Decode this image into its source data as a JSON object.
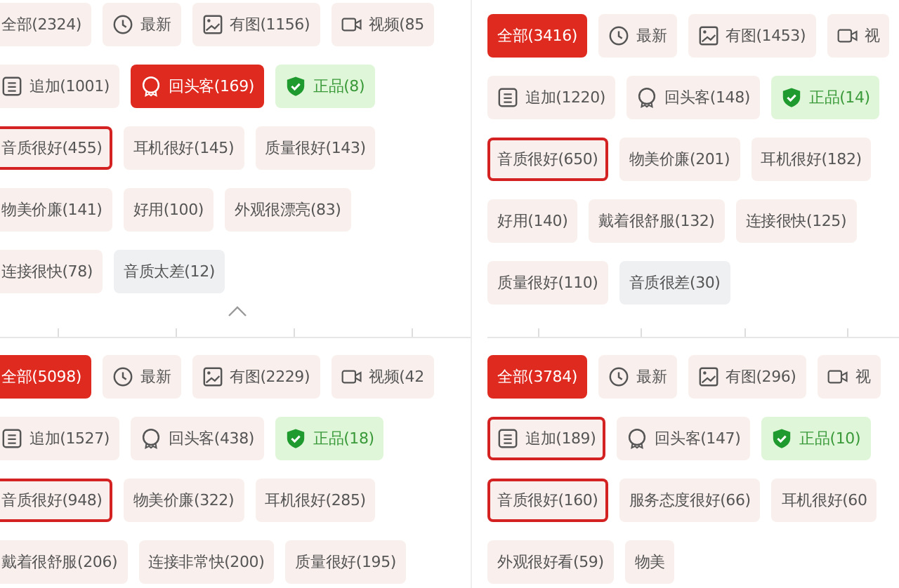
{
  "panels": [
    {
      "collapse_toggle": true,
      "ruler": false,
      "rows": [
        [
          {
            "kind": "tag",
            "label": "全部(2324)",
            "selected": false,
            "outlined": false
          },
          {
            "kind": "latest",
            "label": "最新",
            "selected": false,
            "outlined": false
          },
          {
            "kind": "photo",
            "label": "有图(1156)",
            "selected": false,
            "outlined": false
          },
          {
            "kind": "video",
            "label": "视频(85",
            "selected": false,
            "outlined": false
          }
        ],
        [
          {
            "kind": "followup",
            "label": "追加(1001)",
            "selected": false,
            "outlined": false
          },
          {
            "kind": "repeat",
            "label": "回头客(169)",
            "selected": true,
            "outlined": false
          },
          {
            "kind": "genuine",
            "label": "正品(8)",
            "selected": false,
            "outlined": false
          }
        ],
        [
          {
            "kind": "tag",
            "label": "音质很好(455)",
            "selected": false,
            "outlined": true
          },
          {
            "kind": "tag",
            "label": "耳机很好(145)",
            "selected": false,
            "outlined": false
          },
          {
            "kind": "tag",
            "label": "质量很好(143)",
            "selected": false,
            "outlined": false
          }
        ],
        [
          {
            "kind": "tag",
            "label": "物美价廉(141)",
            "selected": false,
            "outlined": false
          },
          {
            "kind": "tag",
            "label": "好用(100)",
            "selected": false,
            "outlined": false
          },
          {
            "kind": "tag",
            "label": "外观很漂亮(83)",
            "selected": false,
            "outlined": false
          }
        ],
        [
          {
            "kind": "tag",
            "label": "连接很快(78)",
            "selected": false,
            "outlined": false
          },
          {
            "kind": "negative",
            "label": "音质太差(12)",
            "selected": false,
            "outlined": false
          }
        ]
      ]
    },
    {
      "collapse_toggle": false,
      "ruler": false,
      "rows": [
        [
          {
            "kind": "tag",
            "label": "全部(3416)",
            "selected": true,
            "outlined": false
          },
          {
            "kind": "latest",
            "label": "最新",
            "selected": false,
            "outlined": false
          },
          {
            "kind": "photo",
            "label": "有图(1453)",
            "selected": false,
            "outlined": false
          },
          {
            "kind": "video",
            "label": "视",
            "selected": false,
            "outlined": false
          }
        ],
        [
          {
            "kind": "followup",
            "label": "追加(1220)",
            "selected": false,
            "outlined": false
          },
          {
            "kind": "repeat",
            "label": "回头客(148)",
            "selected": false,
            "outlined": false
          },
          {
            "kind": "genuine",
            "label": "正品(14)",
            "selected": false,
            "outlined": false
          }
        ],
        [
          {
            "kind": "tag",
            "label": "音质很好(650)",
            "selected": false,
            "outlined": true
          },
          {
            "kind": "tag",
            "label": "物美价廉(201)",
            "selected": false,
            "outlined": false
          },
          {
            "kind": "tag",
            "label": "耳机很好(182)",
            "selected": false,
            "outlined": false
          }
        ],
        [
          {
            "kind": "tag",
            "label": "好用(140)",
            "selected": false,
            "outlined": false
          },
          {
            "kind": "tag",
            "label": "戴着很舒服(132)",
            "selected": false,
            "outlined": false
          },
          {
            "kind": "tag",
            "label": "连接很快(125)",
            "selected": false,
            "outlined": false
          }
        ],
        [
          {
            "kind": "tag",
            "label": "质量很好(110)",
            "selected": false,
            "outlined": false
          },
          {
            "kind": "negative",
            "label": "音质很差(30)",
            "selected": false,
            "outlined": false
          }
        ]
      ]
    },
    {
      "collapse_toggle": false,
      "ruler": true,
      "rows": [
        [
          {
            "kind": "tag",
            "label": "全部(5098)",
            "selected": true,
            "outlined": false
          },
          {
            "kind": "latest",
            "label": "最新",
            "selected": false,
            "outlined": false
          },
          {
            "kind": "photo",
            "label": "有图(2229)",
            "selected": false,
            "outlined": false
          },
          {
            "kind": "video",
            "label": "视频(42",
            "selected": false,
            "outlined": false
          }
        ],
        [
          {
            "kind": "followup",
            "label": "追加(1527)",
            "selected": false,
            "outlined": false
          },
          {
            "kind": "repeat",
            "label": "回头客(438)",
            "selected": false,
            "outlined": false
          },
          {
            "kind": "genuine",
            "label": "正品(18)",
            "selected": false,
            "outlined": false
          }
        ],
        [
          {
            "kind": "tag",
            "label": "音质很好(948)",
            "selected": false,
            "outlined": true
          },
          {
            "kind": "tag",
            "label": "物美价廉(322)",
            "selected": false,
            "outlined": false
          },
          {
            "kind": "tag",
            "label": "耳机很好(285)",
            "selected": false,
            "outlined": false
          }
        ],
        [
          {
            "kind": "tag",
            "label": "戴着很舒服(206)",
            "selected": false,
            "outlined": false
          },
          {
            "kind": "tag",
            "label": "连接非常快(200)",
            "selected": false,
            "outlined": false
          },
          {
            "kind": "tag",
            "label": "质量很好(195)",
            "selected": false,
            "outlined": false
          }
        ]
      ]
    },
    {
      "collapse_toggle": false,
      "ruler": true,
      "rows": [
        [
          {
            "kind": "tag",
            "label": "全部(3784)",
            "selected": true,
            "outlined": false
          },
          {
            "kind": "latest",
            "label": "最新",
            "selected": false,
            "outlined": false
          },
          {
            "kind": "photo",
            "label": "有图(296)",
            "selected": false,
            "outlined": false
          },
          {
            "kind": "video",
            "label": "视",
            "selected": false,
            "outlined": false
          }
        ],
        [
          {
            "kind": "followup",
            "label": "追加(189)",
            "selected": false,
            "outlined": true
          },
          {
            "kind": "repeat",
            "label": "回头客(147)",
            "selected": false,
            "outlined": false
          },
          {
            "kind": "genuine",
            "label": "正品(10)",
            "selected": false,
            "outlined": false
          }
        ],
        [
          {
            "kind": "tag",
            "label": "音质很好(160)",
            "selected": false,
            "outlined": true
          },
          {
            "kind": "tag",
            "label": "服务态度很好(66)",
            "selected": false,
            "outlined": false
          },
          {
            "kind": "tag",
            "label": "耳机很好(60",
            "selected": false,
            "outlined": false
          }
        ],
        [
          {
            "kind": "tag",
            "label": "外观很好看(59)",
            "selected": false,
            "outlined": false
          },
          {
            "kind": "tag",
            "label": "物美",
            "selected": false,
            "outlined": false
          }
        ]
      ]
    }
  ]
}
